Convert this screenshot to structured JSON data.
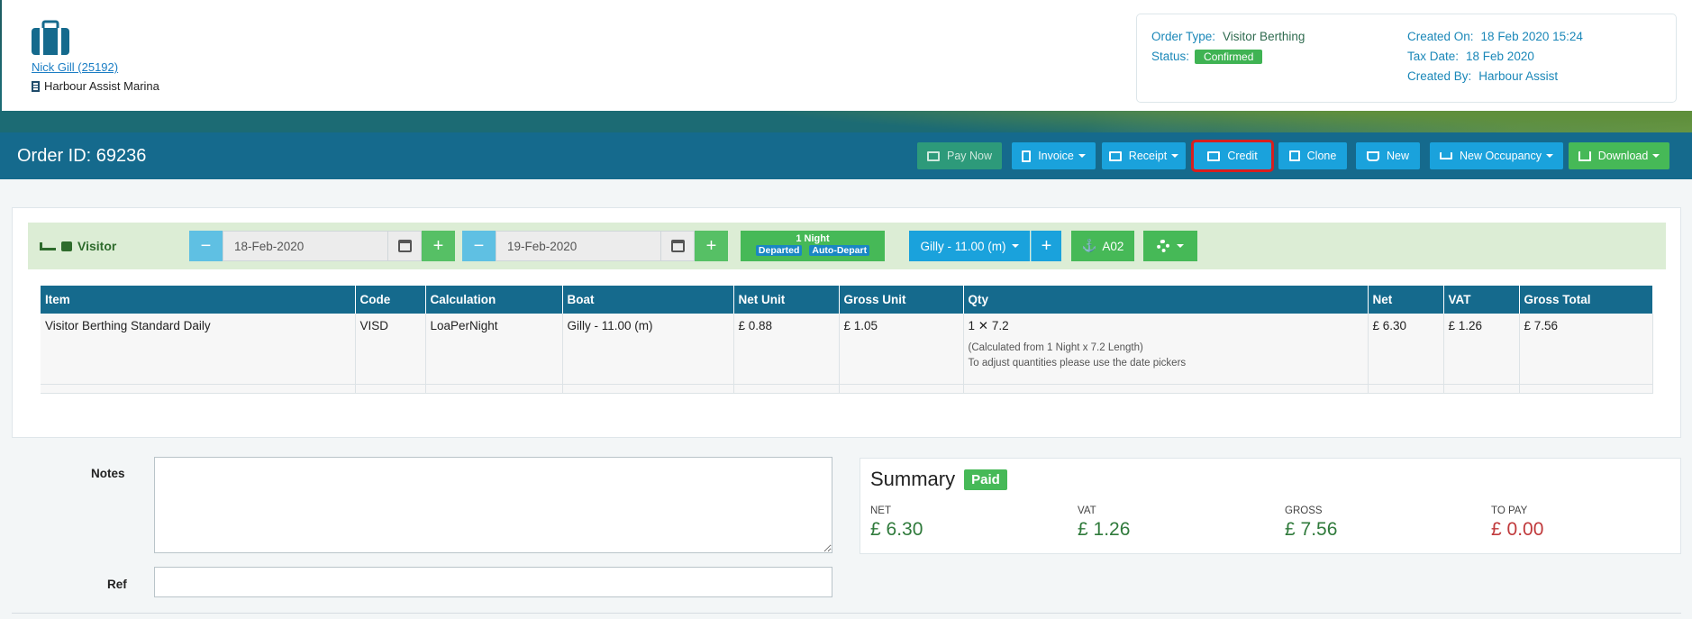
{
  "header": {
    "customer_link": "Nick Gill (25192)",
    "marina": "Harbour Assist Marina",
    "info": {
      "order_type_label": "Order Type:",
      "order_type_value": "Visitor Berthing",
      "status_label": "Status:",
      "status_value": "Confirmed",
      "created_on_label": "Created On:",
      "created_on_value": "18 Feb 2020 15:24",
      "tax_date_label": "Tax Date:",
      "tax_date_value": "18 Feb 2020",
      "created_by_label": "Created By:",
      "created_by_value": "Harbour Assist"
    }
  },
  "orderbar": {
    "title": "Order ID: 69236",
    "buttons": {
      "pay_now": "Pay Now",
      "invoice": "Invoice",
      "receipt": "Receipt",
      "credit": "Credit",
      "clone": "Clone",
      "new": "New",
      "new_occupancy": "New Occupancy",
      "download": "Download"
    }
  },
  "visit": {
    "label": "Visitor",
    "from_date": "18-Feb-2020",
    "to_date": "19-Feb-2020",
    "nights": "1 Night",
    "departed": "Departed",
    "auto_depart": "Auto-Depart",
    "boat": "Gilly - 11.00 (m)",
    "berth": "A02"
  },
  "table": {
    "headers": [
      "Item",
      "Code",
      "Calculation",
      "Boat",
      "Net Unit",
      "Gross Unit",
      "Qty",
      "Net",
      "VAT",
      "Gross Total"
    ],
    "row": {
      "item": "Visitor Berthing Standard Daily",
      "code": "VISD",
      "calculation": "LoaPerNight",
      "boat": "Gilly - 11.00 (m)",
      "net_unit": "£ 0.88",
      "gross_unit": "£ 1.05",
      "qty": "1 ✕ 7.2",
      "qty_note_1": "(Calculated from 1 Night x 7.2 Length)",
      "qty_note_2": "To adjust quantities please use the date pickers",
      "net": "£ 6.30",
      "vat": "£ 1.26",
      "gross_total": "£ 7.56"
    }
  },
  "form": {
    "notes_label": "Notes",
    "notes_value": "",
    "ref_label": "Ref",
    "ref_value": ""
  },
  "summary": {
    "title": "Summary",
    "badge": "Paid",
    "net_label": "NET",
    "net_value": "£ 6.30",
    "vat_label": "VAT",
    "vat_value": "£ 1.26",
    "gross_label": "GROSS",
    "gross_value": "£ 7.56",
    "to_pay_label": "TO PAY",
    "to_pay_value": "£ 0.00"
  },
  "colors": {
    "primary_bar": "#156a8d",
    "green": "#46b957",
    "blue": "#1aa2dc",
    "highlight": "#d81e1e"
  }
}
